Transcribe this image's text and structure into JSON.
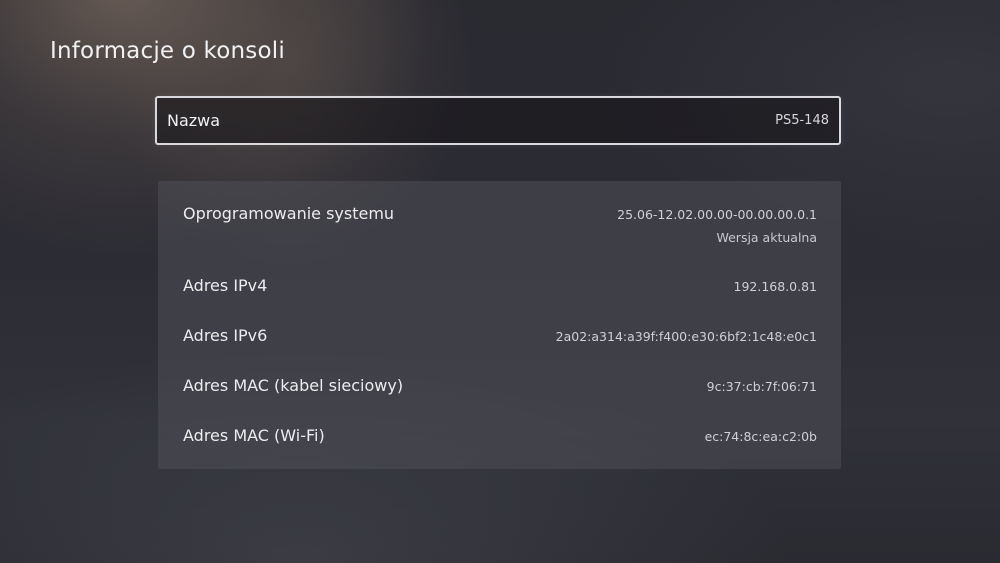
{
  "header": {
    "title": "Informacje o konsoli"
  },
  "name_row": {
    "label": "Nazwa",
    "value": "PS5-148"
  },
  "info": {
    "rows": [
      {
        "label": "Oprogramowanie systemu",
        "value": "25.06-12.02.00.00-00.00.00.0.1",
        "sub": "Wersja aktualna"
      },
      {
        "label": "Adres IPv4",
        "value": "192.168.0.81"
      },
      {
        "label": "Adres IPv6",
        "value": "2a02:a314:a39f:f400:e30:6bf2:1c48:e0c1"
      },
      {
        "label": "Adres MAC (kabel sieciowy)",
        "value": "9c:37:cb:7f:06:71"
      },
      {
        "label": "Adres MAC (Wi-Fi)",
        "value": "ec:74:8c:ea:c2:0b"
      }
    ]
  }
}
